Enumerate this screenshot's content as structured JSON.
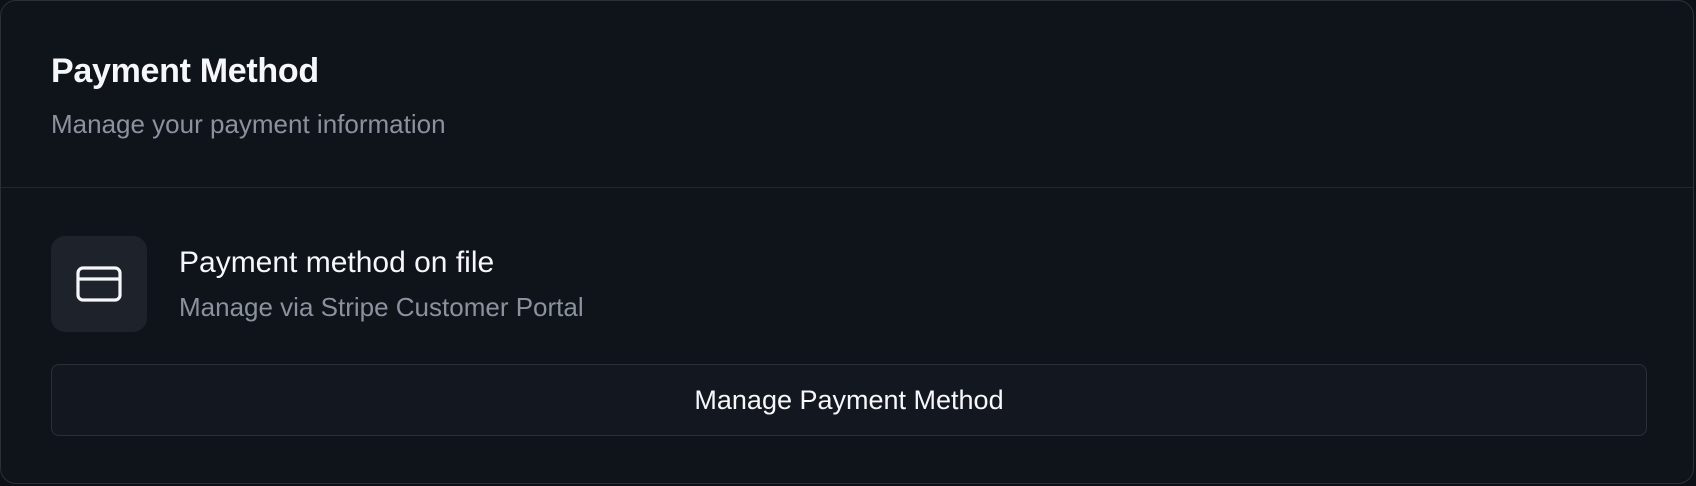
{
  "card": {
    "title": "Payment Method",
    "subtitle": "Manage your payment information"
  },
  "payment_method": {
    "icon": "credit-card-icon",
    "title": "Payment method on file",
    "description": "Manage via Stripe Customer Portal"
  },
  "actions": {
    "manage_label": "Manage Payment Method"
  },
  "colors": {
    "background": "#0f131a",
    "border": "#2b3038",
    "icon_tile": "#1e222b",
    "text_primary": "#f5f7fa",
    "text_muted": "#8b929d"
  }
}
